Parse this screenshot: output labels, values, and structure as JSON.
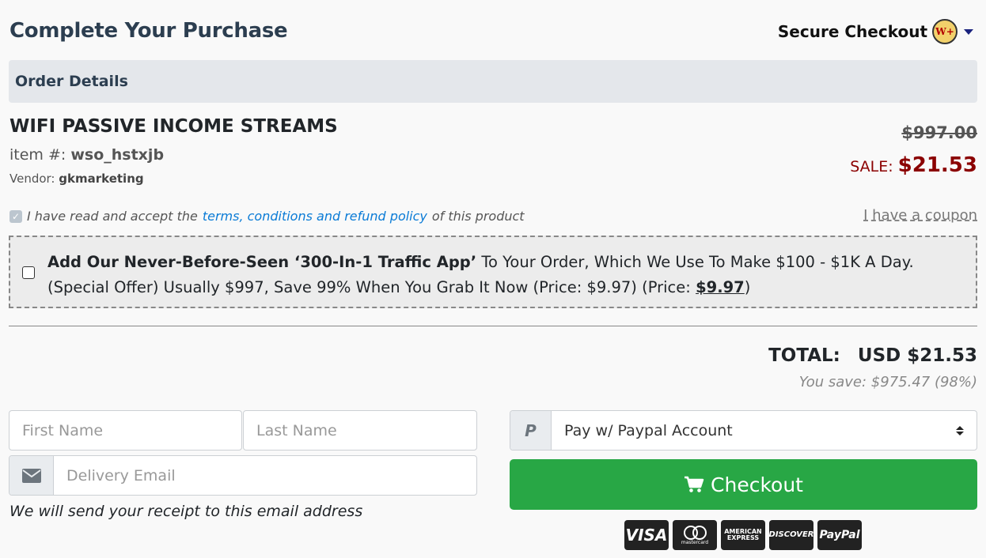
{
  "header": {
    "title": "Complete Your Purchase",
    "secure_label": "Secure Checkout",
    "logo_text": "W+"
  },
  "order": {
    "section_label": "Order Details",
    "product_name": "WIFI PASSIVE INCOME STREAMS",
    "item_label": "item #:",
    "item_id": "wso_hstxjb",
    "vendor_label": "Vendor:",
    "vendor": "gkmarketing",
    "original_price": "$997.00",
    "sale_label": "SALE:",
    "sale_price": "$21.53"
  },
  "terms": {
    "prefix": "I have read and accept the",
    "link": "terms, conditions and refund policy",
    "suffix": "of this product",
    "coupon": "I have a coupon",
    "checked": true
  },
  "offer": {
    "bold": "Add Our Never-Before-Seen ‘300-In-1 Traffic App’",
    "text": " To Your Order, Which We Use To Make $100 - $1K A Day. (Special Offer) Usually $997, Save 99% When You Grab It Now (Price: $9.97) (Price: ",
    "price": "$9.97",
    "close": ")",
    "checked": false
  },
  "totals": {
    "label": "TOTAL:",
    "value": "USD $21.53",
    "savings": "You save: $975.47 (98%)"
  },
  "form": {
    "first_name_placeholder": "First Name",
    "last_name_placeholder": "Last Name",
    "email_placeholder": "Delivery Email",
    "receipt_note": "We will send your receipt to this email address",
    "payment_selected": "Pay w/ Paypal Account",
    "checkout_label": "Checkout"
  },
  "icons": {
    "email": "envelope-icon",
    "paypal": "paypal-icon",
    "cart": "cart-icon"
  },
  "cards": [
    "VISA",
    "mastercard",
    "AMERICAN EXPRESS",
    "DISCOVER",
    "PayPal"
  ],
  "colors": {
    "sale": "#8b0000",
    "checkout": "#28a745",
    "link": "#0a7bd6"
  }
}
